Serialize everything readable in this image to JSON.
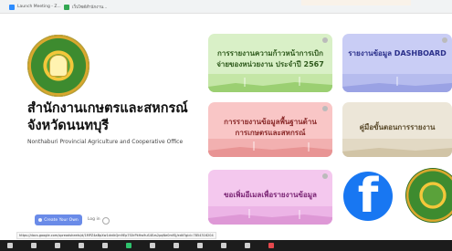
{
  "browser": {
    "tabs": [
      {
        "label": "Launch Meeting - Z..."
      },
      {
        "label": "เว็บไซต์สำนักงาน..."
      }
    ]
  },
  "hero": {
    "org_name_th": "สำนักงานเกษตรและสหกรณ์จังหวัดนนทบุรี",
    "org_name_en": "Nonthaburi Provincial Agriculture and Cooperative Office",
    "create_button": "Create Your Own",
    "login_label": "Log in"
  },
  "cards": [
    {
      "label": "การรายงานความก้าวหน้าการเบิกจ่ายของหน่วยงาน ประจำปี 2567"
    },
    {
      "label": "รายงานข้อมูล DASHBOARD"
    },
    {
      "label": "การรายงานข้อมูลพื้นฐานด้านการเกษตรและสหกรณ์"
    },
    {
      "label": "คู่มือขั้นตอนการรายงาน"
    },
    {
      "label": "ขอเพิ่มอีเมลเพื่อรายงานข้อมูล"
    }
  ],
  "facebook": {
    "glyph": "f"
  },
  "status_url": "https://docs.google.com/spreadsheets/d/1MPZ4aBpXw1drdkQm9Ep7S0rPkHw9uS4Ezs2pqNe0mfSj/edit?gid=7854316204",
  "colors": {
    "card1_bg": "#d9f0c7",
    "card2_bg": "#f9c6c6",
    "card3_bg": "#f4c8ee",
    "card4_bg": "#c9cdf5",
    "card5_bg": "#ece6d8",
    "facebook": "#1877f2",
    "create_button": "#6a8be8",
    "zoom_bar": "#1c1c1c"
  },
  "icons": {
    "zoom_bar": [
      "microphone-icon",
      "video-icon",
      "security-icon",
      "participants-icon",
      "chat-icon",
      "share-screen-icon",
      "record-icon",
      "reactions-icon",
      "apps-icon",
      "whiteboard-icon",
      "more-icon",
      "leave-icon"
    ]
  }
}
